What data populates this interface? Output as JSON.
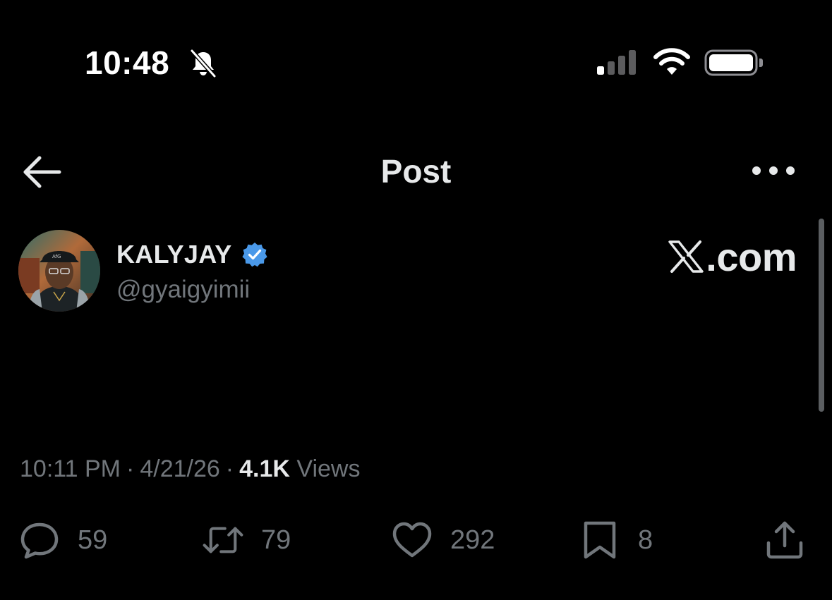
{
  "status_bar": {
    "time": "10:48",
    "icons": [
      "bell-slash-icon",
      "cellular-signal-icon",
      "wifi-icon",
      "battery-icon"
    ]
  },
  "nav": {
    "title": "Post",
    "back_icon": "arrow-left-icon",
    "more_icon": "ellipsis-icon"
  },
  "post": {
    "author": {
      "name": "KALYJAY",
      "handle": "@gyaigyimii",
      "verified": true,
      "verified_color": "#4a99e9"
    },
    "brand": "X.com",
    "brand_suffix": ".com",
    "meta": {
      "time": "10:11 PM",
      "date": "4/21/26",
      "separator": "·",
      "views_count": "4.1K",
      "views_label": "Views"
    },
    "actions": {
      "replies": "59",
      "reposts": "79",
      "likes": "292",
      "bookmarks": "8"
    }
  },
  "colors": {
    "background": "#000000",
    "text_primary": "#e7e9ea",
    "text_secondary": "#71767b",
    "accent": "#4a99e9"
  }
}
